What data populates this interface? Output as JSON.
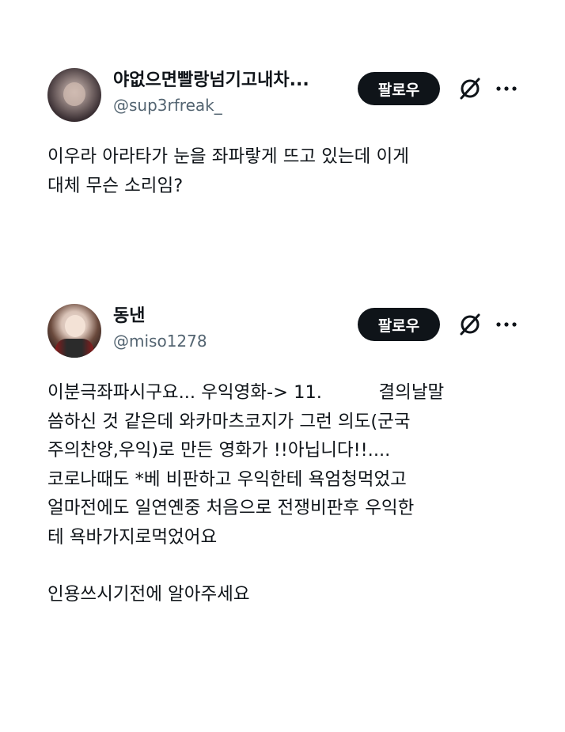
{
  "posts": [
    {
      "display_name": "야없으면빨랑넘기고내차...",
      "handle": "@sup3rfreak_",
      "follow_label": "팔로우",
      "icons": [
        "grok-icon",
        "more-icon"
      ],
      "text_lines": [
        "이우라 아라타가 눈을 좌파랗게 뜨고 있는데 이게",
        "대체 무슨 소리임?"
      ]
    },
    {
      "display_name": "동낸",
      "handle": "@miso1278",
      "follow_label": "팔로우",
      "icons": [
        "grok-icon",
        "more-icon"
      ],
      "text_lines": [
        "이분극좌파시구요... 우익영화-> 11.          결의날말",
        "씀하신 것 같은데 와카마츠코지가 그런 의도(군국",
        "주의찬양,우익)로 만든 영화가 !!아닙니다!!....",
        "코로나때도 *베 비판하고 우익한테 욕엄청먹었고",
        "얼마전에도 일연옌중 처음으로 전쟁비판후 우익한",
        "테 욕바가지로먹었어요",
        "",
        "인용쓰시기전에 알아주세요"
      ]
    }
  ]
}
